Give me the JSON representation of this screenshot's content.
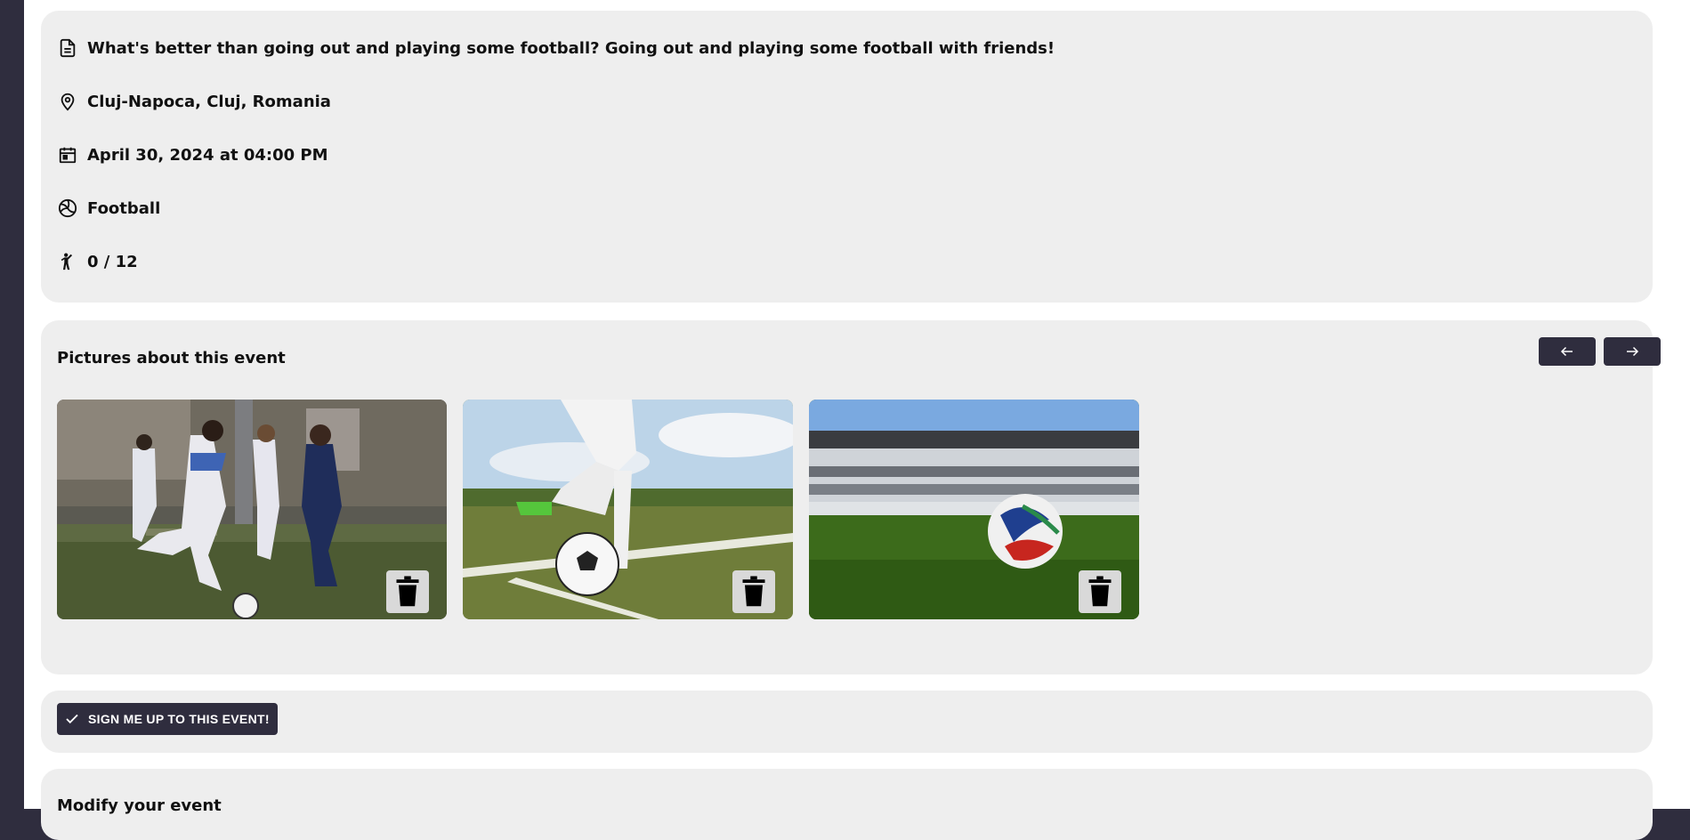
{
  "event_info": {
    "description": "What's better than going out and playing some football? Going out and playing some football with friends!",
    "location": "Cluj-Napoca, Cluj, Romania",
    "datetime": "April 30, 2024 at 04:00 PM",
    "sport": "Football",
    "participants": "0 / 12"
  },
  "pictures": {
    "title": "Pictures about this event",
    "prev_icon": "arrow-left-icon",
    "next_icon": "arrow-right-icon",
    "items": [
      {
        "subject": "women playing football",
        "delete_icon": "trash-icon"
      },
      {
        "subject": "player kicking football on pitch",
        "delete_icon": "trash-icon"
      },
      {
        "subject": "football on stadium grass",
        "delete_icon": "trash-icon"
      }
    ]
  },
  "signup": {
    "label": "SIGN ME UP TO THIS EVENT!",
    "icon": "check-icon"
  },
  "modify": {
    "title": "Modify your event"
  },
  "colors": {
    "sidebar": "#2f2d3e",
    "card": "#eeeeee",
    "button": "#2f2d3e"
  }
}
